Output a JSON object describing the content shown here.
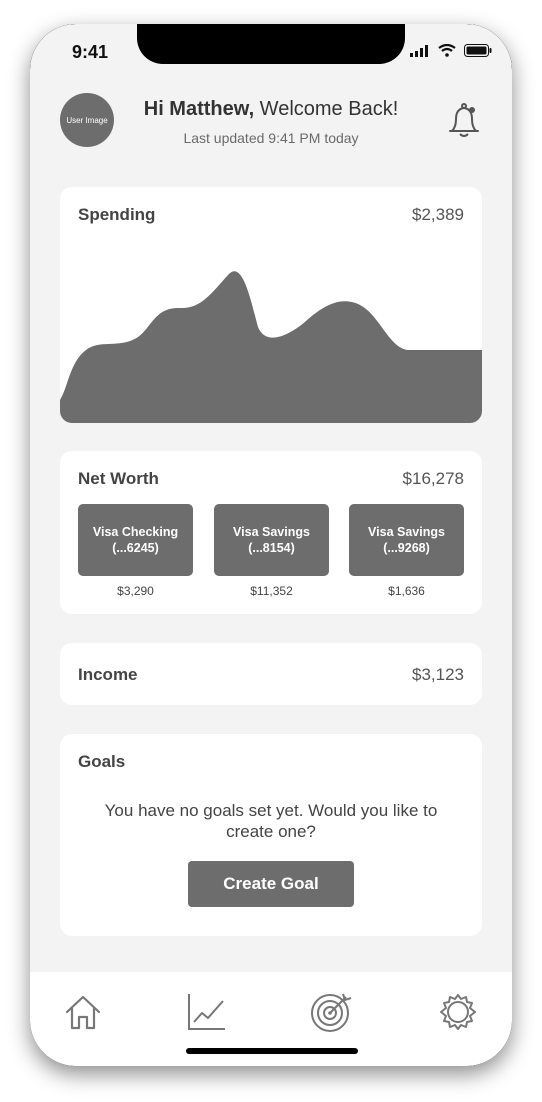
{
  "status_bar": {
    "time": "9:41"
  },
  "header": {
    "avatar_text": "User Image",
    "greeting_bold": "Hi Matthew,",
    "greeting_rest": " Welcome Back!",
    "updated": "Last updated 9:41 PM today",
    "bell_icon": "bell-icon"
  },
  "spending": {
    "title": "Spending",
    "amount": "$2,389"
  },
  "net_worth": {
    "title": "Net Worth",
    "amount": "$16,278",
    "accounts": [
      {
        "name": "Visa Checking",
        "number": "(...6245)",
        "balance": "$3,290"
      },
      {
        "name": "Visa Savings",
        "number": "(...8154)",
        "balance": "$11,352"
      },
      {
        "name": "Visa Savings",
        "number": "(...9268)",
        "balance": "$1,636"
      }
    ]
  },
  "income": {
    "title": "Income",
    "amount": "$3,123"
  },
  "goals": {
    "title": "Goals",
    "message": "You have no goals set yet. Would you like to create one?",
    "button": "Create Goal"
  },
  "tabbar": {
    "items": [
      {
        "icon": "home-icon"
      },
      {
        "icon": "chart-icon"
      },
      {
        "icon": "target-icon"
      },
      {
        "icon": "gear-icon"
      }
    ]
  },
  "colors": {
    "accent": "#6d6d6d",
    "background": "#f3f3f3",
    "card": "#ffffff"
  }
}
